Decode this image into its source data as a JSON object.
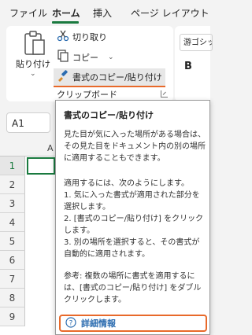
{
  "tabs": [
    "ファイル",
    "ホーム",
    "挿入",
    "ページ レイアウト"
  ],
  "clipboard": {
    "paste_label": "貼り付け",
    "cut_label": "切り取り",
    "copy_label": "コピー",
    "format_painter_label": "書式のコピー/貼り付け",
    "group_label": "クリップボード"
  },
  "font": {
    "name": "游ゴシッ",
    "bold": "B"
  },
  "namebox": {
    "value": "A1"
  },
  "grid": {
    "column_partial": "A",
    "rows": [
      "1",
      "2",
      "3",
      "4",
      "5",
      "6",
      "7",
      "8",
      "9"
    ]
  },
  "tooltip": {
    "title": "書式のコピー/貼り付け",
    "description": "見た目が気に入った場所がある場合は、その見た目をドキュメント内の別の場所に適用することもできます。",
    "howto_intro": "適用するには、次のようにします。",
    "step1": "1. 気に入った書式が適用された部分を選択します。",
    "step2": "2. [書式のコピー/貼り付け] をクリックします。",
    "step3": "3. 別の場所を選択すると、その書式が自動的に適用されます。",
    "note": "参考: 複数の場所に書式を適用するには、[書式のコピー/貼り付け] をダブルクリックします。",
    "more_info": "詳細情報"
  },
  "colors": {
    "accent_green": "#1a7a3f",
    "highlight_orange": "#e8692a",
    "help_blue": "#2b6cb0"
  }
}
